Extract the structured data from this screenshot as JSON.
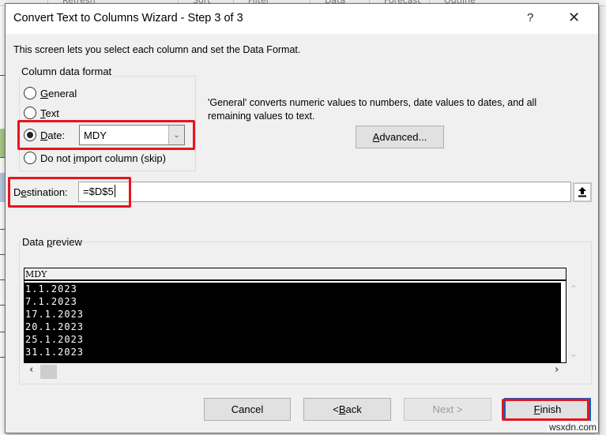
{
  "background": {
    "ribbon_items": [
      "Refresh",
      "Sort",
      "Filter",
      "Data",
      "Forecast",
      "Outline"
    ]
  },
  "dialog": {
    "title": "Convert Text to Columns Wizard - Step 3 of 3",
    "help_label": "?",
    "close_label": "✕",
    "intro": "This screen lets you select each column and set the Data Format."
  },
  "column_format": {
    "legend": "Column data format",
    "options": [
      {
        "label_key": "G",
        "label_rest": "eneral",
        "checked": false
      },
      {
        "label_key": "T",
        "label_rest": "ext",
        "checked": false
      },
      {
        "label_key": "D",
        "label_rest": "ate:",
        "checked": true
      },
      {
        "label_pre": "Do not ",
        "label_key": "i",
        "label_rest": "mport column (skip)",
        "checked": false
      }
    ],
    "date_format_value": "MDY",
    "description": "'General' converts numeric values to numbers, date values to dates, and all remaining values to text.",
    "advanced_key": "A",
    "advanced_rest": "dvanced..."
  },
  "destination": {
    "label_pre": "D",
    "label_key": "e",
    "label_rest": "stination:",
    "value": "=$D$5"
  },
  "preview": {
    "legend_pre": "Data ",
    "legend_key": "p",
    "legend_rest": "review",
    "header": "MDY",
    "rows": [
      "1.1.2023",
      "7.1.2023",
      "17.1.2023",
      "20.1.2023",
      "25.1.2023",
      "31.1.2023"
    ]
  },
  "buttons": {
    "cancel": "Cancel",
    "back_pre": "< ",
    "back_key": "B",
    "back_rest": "ack",
    "next": "Next >",
    "finish_key": "F",
    "finish_rest": "inish"
  },
  "highlight_color": "#e8141b",
  "watermark": "wsxdn.com"
}
